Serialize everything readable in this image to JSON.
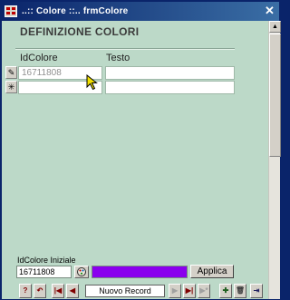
{
  "window": {
    "title": "..:: Colore ::..   frmColore",
    "close_glyph": "✕"
  },
  "form": {
    "heading": "DEFINIZIONE COLORI",
    "columns": [
      "IdColore",
      "Testo"
    ],
    "rows": [
      {
        "selector": "✎",
        "id_colore": "16711808",
        "testo": ""
      },
      {
        "selector": "✳",
        "id_colore": "",
        "testo": ""
      }
    ]
  },
  "footer": {
    "init_label": "IdColore Iniziale",
    "init_value": "16711808",
    "swatch_color": "#8a00ee",
    "apply_label": "Applica"
  },
  "navigation": {
    "record_field": "Nuovo Record",
    "buttons": {
      "help": "?",
      "undo": "↶",
      "first": "|◀",
      "prev": "◀",
      "next": "▶",
      "last": "▶|",
      "new": "▶*",
      "add": "✚",
      "delete": "🗑",
      "exit": "⇥"
    }
  },
  "colors": {
    "form_bg": "#bcd9c8",
    "titlebar": "#0a246a",
    "accent": "#8a00ee"
  }
}
